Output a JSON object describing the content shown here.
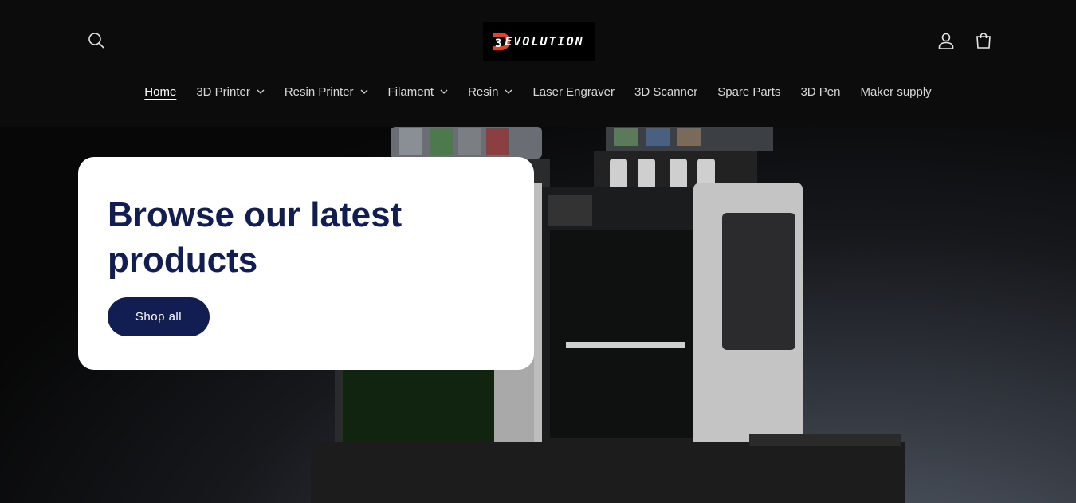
{
  "header": {
    "logo_text": "EVOLUTION",
    "logo_mark": "3",
    "icons": {
      "search": "search-icon",
      "account": "user-icon",
      "cart": "bag-icon"
    }
  },
  "nav": {
    "items": [
      {
        "label": "Home",
        "dropdown": false,
        "active": true
      },
      {
        "label": "3D Printer",
        "dropdown": true
      },
      {
        "label": "Resin Printer",
        "dropdown": true
      },
      {
        "label": "Filament",
        "dropdown": true
      },
      {
        "label": "Resin",
        "dropdown": true
      },
      {
        "label": "Laser Engraver",
        "dropdown": false
      },
      {
        "label": "3D Scanner",
        "dropdown": false
      },
      {
        "label": "Spare Parts",
        "dropdown": false
      },
      {
        "label": "3D Pen",
        "dropdown": false
      },
      {
        "label": "Maker supply",
        "dropdown": false
      }
    ]
  },
  "hero": {
    "heading": "Browse our latest products",
    "button_label": "Shop all"
  },
  "colors": {
    "brand_navy": "#121e51",
    "header_bg": "#0c0c0c",
    "logo_accent": "#e0452b"
  }
}
